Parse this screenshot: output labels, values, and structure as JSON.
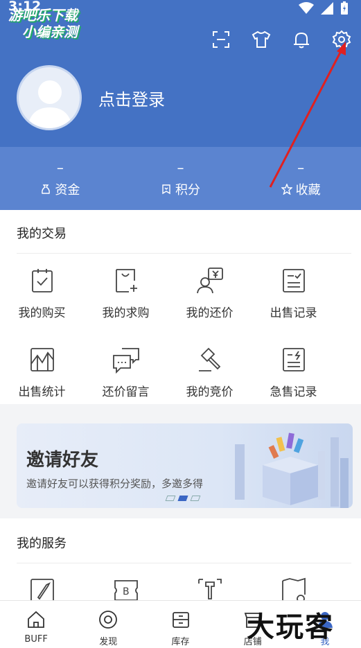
{
  "status_bar": {
    "time": "3:12"
  },
  "watermark_top": {
    "line1": "游吧乐下载",
    "line2": "小编亲测"
  },
  "watermark_bottom": "大玩客",
  "top_actions": [
    "scan-icon",
    "tshirt-icon",
    "bell-icon",
    "gear-icon"
  ],
  "profile": {
    "login_text": "点击登录"
  },
  "stats": [
    {
      "value": "–",
      "label": "资金",
      "icon": "money-bag-icon"
    },
    {
      "value": "–",
      "label": "积分",
      "icon": "points-icon"
    },
    {
      "value": "–",
      "label": "收藏",
      "icon": "star-icon"
    }
  ],
  "transactions": {
    "title": "我的交易",
    "items": [
      {
        "label": "我的购买",
        "icon": "clipboard-check-icon"
      },
      {
        "label": "我的求购",
        "icon": "bag-plus-icon"
      },
      {
        "label": "我的还价",
        "icon": "person-yen-icon"
      },
      {
        "label": "出售记录",
        "icon": "list-check-icon"
      },
      {
        "label": "出售统计",
        "icon": "chart-icon"
      },
      {
        "label": "还价留言",
        "icon": "chat-bubbles-icon"
      },
      {
        "label": "我的竞价",
        "icon": "gavel-icon"
      },
      {
        "label": "急售记录",
        "icon": "flash-list-icon"
      }
    ]
  },
  "banner": {
    "title": "邀请好友",
    "subtitle": "邀请好友可以获得积分奖励，多邀多得",
    "active_slide": 2,
    "slide_count": 3
  },
  "services": {
    "title": "我的服务",
    "items": [
      {
        "icon": "rocket-icon"
      },
      {
        "icon": "ticket-b-icon"
      },
      {
        "icon": "tower-icon"
      },
      {
        "icon": "map-pin-icon"
      }
    ]
  },
  "bottom_nav": [
    {
      "label": "BUFF",
      "icon": "home-icon",
      "active": false
    },
    {
      "label": "发现",
      "icon": "discover-icon",
      "active": false
    },
    {
      "label": "库存",
      "icon": "inventory-icon",
      "active": false
    },
    {
      "label": "店铺",
      "icon": "shop-icon",
      "active": false
    },
    {
      "label": "我",
      "icon": "me-icon",
      "active": true
    }
  ],
  "colors": {
    "header": "#4472c4",
    "accent": "#3a66c4",
    "arrow": "#e02020"
  }
}
